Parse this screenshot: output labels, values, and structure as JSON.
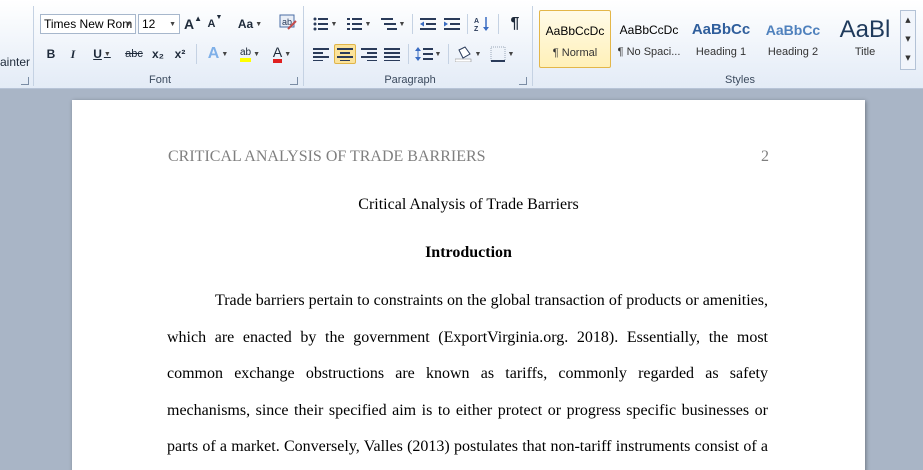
{
  "ribbon": {
    "clipboard_fragment": "ainter",
    "font": {
      "group_label": "Font",
      "font_name": "Times New Rom",
      "font_size": "12",
      "grow_glyph": "A",
      "shrink_glyph": "A",
      "change_case": "Aa",
      "bold": "B",
      "italic": "I",
      "underline": "U",
      "strike": "abc",
      "subscript": "x₂",
      "superscript": "x²",
      "text_effects": "A",
      "highlight": "ab",
      "font_color": "A"
    },
    "paragraph": {
      "group_label": "Paragraph",
      "show_marks": "¶"
    },
    "styles": {
      "group_label": "Styles",
      "items": [
        {
          "preview": "AaBbCcDc",
          "name": "¶ Normal"
        },
        {
          "preview": "AaBbCcDc",
          "name": "¶ No Spaci..."
        },
        {
          "preview": "AaBbCc",
          "name": "Heading 1"
        },
        {
          "preview": "AaBbCc",
          "name": "Heading 2"
        },
        {
          "preview": "AaBl",
          "name": "Title"
        }
      ]
    }
  },
  "document": {
    "header_title": "CRITICAL ANALYSIS OF TRADE BARRIERS",
    "page_number": "2",
    "title": "Critical Analysis of Trade Barriers",
    "heading": "Introduction",
    "lines": [
      "Trade barriers pertain to constraints on the global transaction of products or amenities,",
      "which are enacted by the government (ExportVirginia.org. 2018). Essentially, the most",
      "common exchange obstructions are known as tariffs, commonly regarded as safety",
      "mechanisms, since their specified aim is to either protect or progress specific businesses or",
      "parts of a market. Conversely, Valles (2013) postulates that non-tariff instruments consist of a"
    ]
  }
}
